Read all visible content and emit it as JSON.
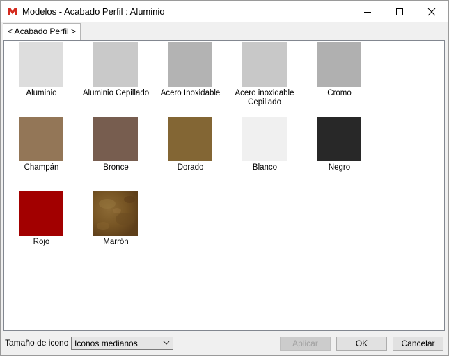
{
  "window": {
    "title": "Modelos - Acabado Perfil :  Aluminio"
  },
  "tabs": [
    {
      "label": "< Acabado Perfil  >"
    }
  ],
  "finishes": [
    {
      "label": "Aluminio",
      "color": "#dddddd"
    },
    {
      "label": "Aluminio Cepillado",
      "color": "#c9c9c9"
    },
    {
      "label": "Acero Inoxidable",
      "color": "#b3b3b3"
    },
    {
      "label": "Acero inoxidable Cepillado",
      "color": "#c8c8c8"
    },
    {
      "label": "Cromo",
      "color": "#b0b0b0"
    },
    {
      "label": "Champán",
      "color": "#937657"
    },
    {
      "label": "Bronce",
      "color": "#775d4f"
    },
    {
      "label": "Dorado",
      "color": "#836634"
    },
    {
      "label": "Blanco",
      "color": "#f0f0f0"
    },
    {
      "label": "Negro",
      "color": "#282828"
    },
    {
      "label": "Rojo",
      "color": "#a20000"
    },
    {
      "label": "Marrón",
      "color": "#7a5a2a"
    }
  ],
  "footer": {
    "icon_size_label": "Tamaño de icono",
    "icon_size_value": "Iconos medianos",
    "apply_label": "Aplicar",
    "ok_label": "OK",
    "cancel_label": "Cancelar"
  }
}
